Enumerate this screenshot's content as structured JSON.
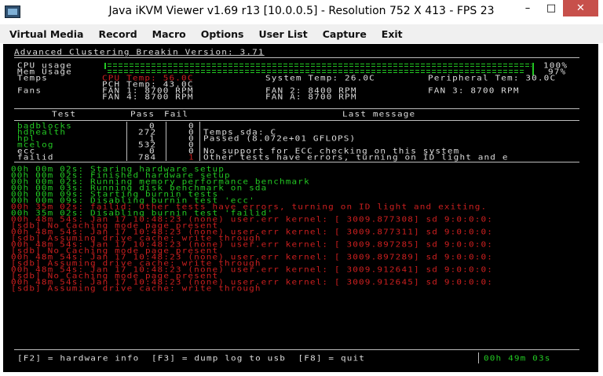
{
  "window": {
    "title": "Java iKVM Viewer v1.69 r13 [10.0.0.5]  - Resolution 752 X 413 - FPS 23",
    "minimize_icon": "minimize-icon",
    "maximize_icon": "maximize-icon",
    "close_icon": "close-icon"
  },
  "menu": {
    "virtual_media": "Virtual Media",
    "record": "Record",
    "macro": "Macro",
    "options": "Options",
    "user_list": "User List",
    "capture": "Capture",
    "exit": "Exit"
  },
  "console": {
    "header_title": "Advanced Clustering Breakin Version: 3.71",
    "cpu_usage_label": "CPU usage",
    "cpu_usage_value": "100%",
    "cpu_usage_fraction": 1.0,
    "mem_usage_label": "Mem Usage",
    "mem_usage_value": "97%",
    "mem_usage_fraction": 0.97,
    "temps_label": "Temps",
    "cpu_temp": "CPU Temp: 56.0C",
    "pch_temp": "PCH Temp: 43.0C",
    "system_temp": "System Temp: 26.0C",
    "peripheral_temp": "Peripheral Tem: 30.0C",
    "fans_label": "Fans",
    "fan1": "FAN 1: 8700 RPM",
    "fan4": "FAN 4: 8700 RPM",
    "fan2": "FAN 2: 8400 RPM",
    "fana": "FAN A: 8700 RPM",
    "fan3": "FAN 3: 8700 RPM",
    "table_headers": {
      "test": "Test",
      "pass": "Pass",
      "fail": "Fail",
      "message": "Last message"
    },
    "tests": [
      {
        "name": "badblocks",
        "pass": "0",
        "fail": "0",
        "message": ""
      },
      {
        "name": "hdhealth",
        "pass": "272",
        "fail": "0",
        "message": "Temps sda: C"
      },
      {
        "name": "hpl",
        "pass": "1",
        "fail": "0",
        "message": "Passed (8.072e+01 GFLOPS)"
      },
      {
        "name": "mcelog",
        "pass": "532",
        "fail": "0",
        "message": ""
      },
      {
        "name": "ecc",
        "pass": "0",
        "fail": "0",
        "message": "No support for ECC checking on this system"
      },
      {
        "name": "failid",
        "pass": "784",
        "fail": "1",
        "message": "Other tests have errors, turning on ID light and e"
      }
    ],
    "log": [
      "00h 00m 02s: Staring hardware setup",
      "00h 00m 02s: Finished hardware setup",
      "00h 00m 02s: Running memory performance benchmark",
      "00h 00m 03s: Running disk benchmark on sda",
      "00h 00m 09s: Starting burnin tests",
      "00h 00m 09s: Disabling burnin test 'ecc'",
      "00h 35m 02s: failid: Other tests have errors, turning on ID light and exiting.",
      "00h 35m 02s: Disabling burnin test 'failid'",
      "00h 48m 54s: Jan 17 10:48:23 (none) user.err kernel: [ 3009.877308] sd 9:0:0:0:",
      "[sdb] No Caching mode page present",
      "00h 48m 54s: Jan 17 10:48:23 (none) user.err kernel: [ 3009.877311] sd 9:0:0:0:",
      "[sdb] Assuming drive cache: write through",
      "00h 48m 54s: Jan 17 10:48:23 (none) user.err kernel: [ 3009.897285] sd 9:0:0:0:",
      "[sdb] No Caching mode page present",
      "00h 48m 54s: Jan 17 10:48:23 (none) user.err kernel: [ 3009.897289] sd 9:0:0:0:",
      "[sdb] Assuming drive cache: write through",
      "00h 48m 54s: Jan 17 10:48:23 (none) user.err kernel: [ 3009.912641] sd 9:0:0:0:",
      "[sdb] No Caching mode page present",
      "00h 48m 54s: Jan 17 10:48:23 (none) user.err kernel: [ 3009.912645] sd 9:0:0:0:",
      "[sdb] Assuming drive cache: write through"
    ],
    "footer_keys": "[F2] = hardware info  [F3] = dump log to usb  [F8] = quit",
    "elapsed": "00h 49m 03s"
  }
}
